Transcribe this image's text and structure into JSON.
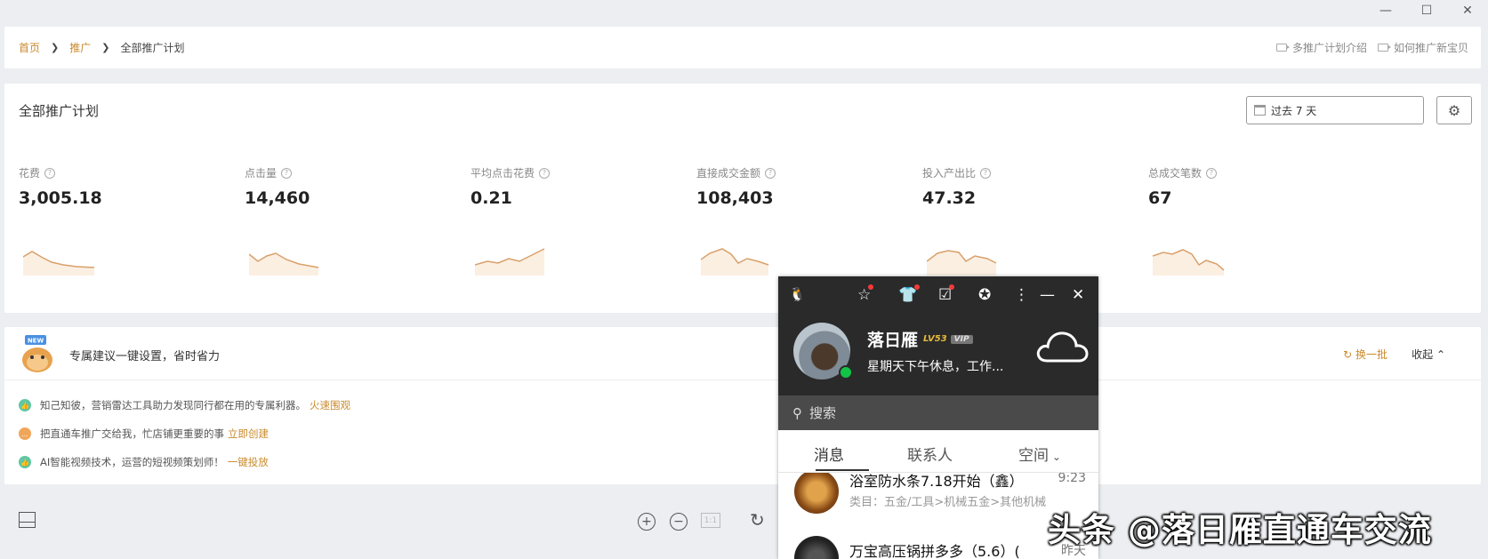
{
  "window": {
    "minimize": "—",
    "maximize": "☐",
    "close": "✕"
  },
  "breadcrumb": {
    "home": "首页",
    "promote": "推广",
    "current": "全部推广计划"
  },
  "help_links": [
    "多推广计划介绍",
    "如何推广新宝贝"
  ],
  "stats": {
    "title": "全部推广计划",
    "date_range": "过去 7 天",
    "metrics": [
      {
        "label": "花费",
        "value": "3,005.18"
      },
      {
        "label": "点击量",
        "value": "14,460"
      },
      {
        "label": "平均点击花费",
        "value": "0.21"
      },
      {
        "label": "直接成交金额",
        "value": "108,403"
      },
      {
        "label": "投入产出比",
        "value": "47.32"
      },
      {
        "label": "总成交笔数",
        "value": "67"
      }
    ]
  },
  "suggestions": {
    "title": "专属建议一键设置，省时省力",
    "refresh_label": "换一批",
    "collapse_label": "收起",
    "items": [
      {
        "text": "知己知彼，营销雷达工具助力发现同行都在用的专属利器。",
        "action": "火速围观",
        "color": "#5fc7a3"
      },
      {
        "text": "把直通车推广交给我，忙店铺更重要的事",
        "action": "立即创建",
        "color": "#f0a65a"
      },
      {
        "text": "AI智能视频技术，运营的短视频策划师！",
        "action": "一键投放",
        "color": "#5fc7a3"
      }
    ]
  },
  "toolbar": {
    "fit_label": "1:1"
  },
  "qq": {
    "name": "落日雁",
    "level": "LV53",
    "vip": "VIP",
    "signature": "星期天下午休息，工作...",
    "search_placeholder": "搜索",
    "tabs": [
      "消息",
      "联系人",
      "空间"
    ],
    "conversations": [
      {
        "title": "浴室防水条7.18开始（鑫）",
        "time": "9:23",
        "subtitle": "类目：五金/工具>机械五金>其他机械"
      },
      {
        "title": "万宝高压锅拼多多（5.6）(",
        "time": "昨天"
      }
    ]
  },
  "watermark": "头条 @落日雁直通车交流"
}
